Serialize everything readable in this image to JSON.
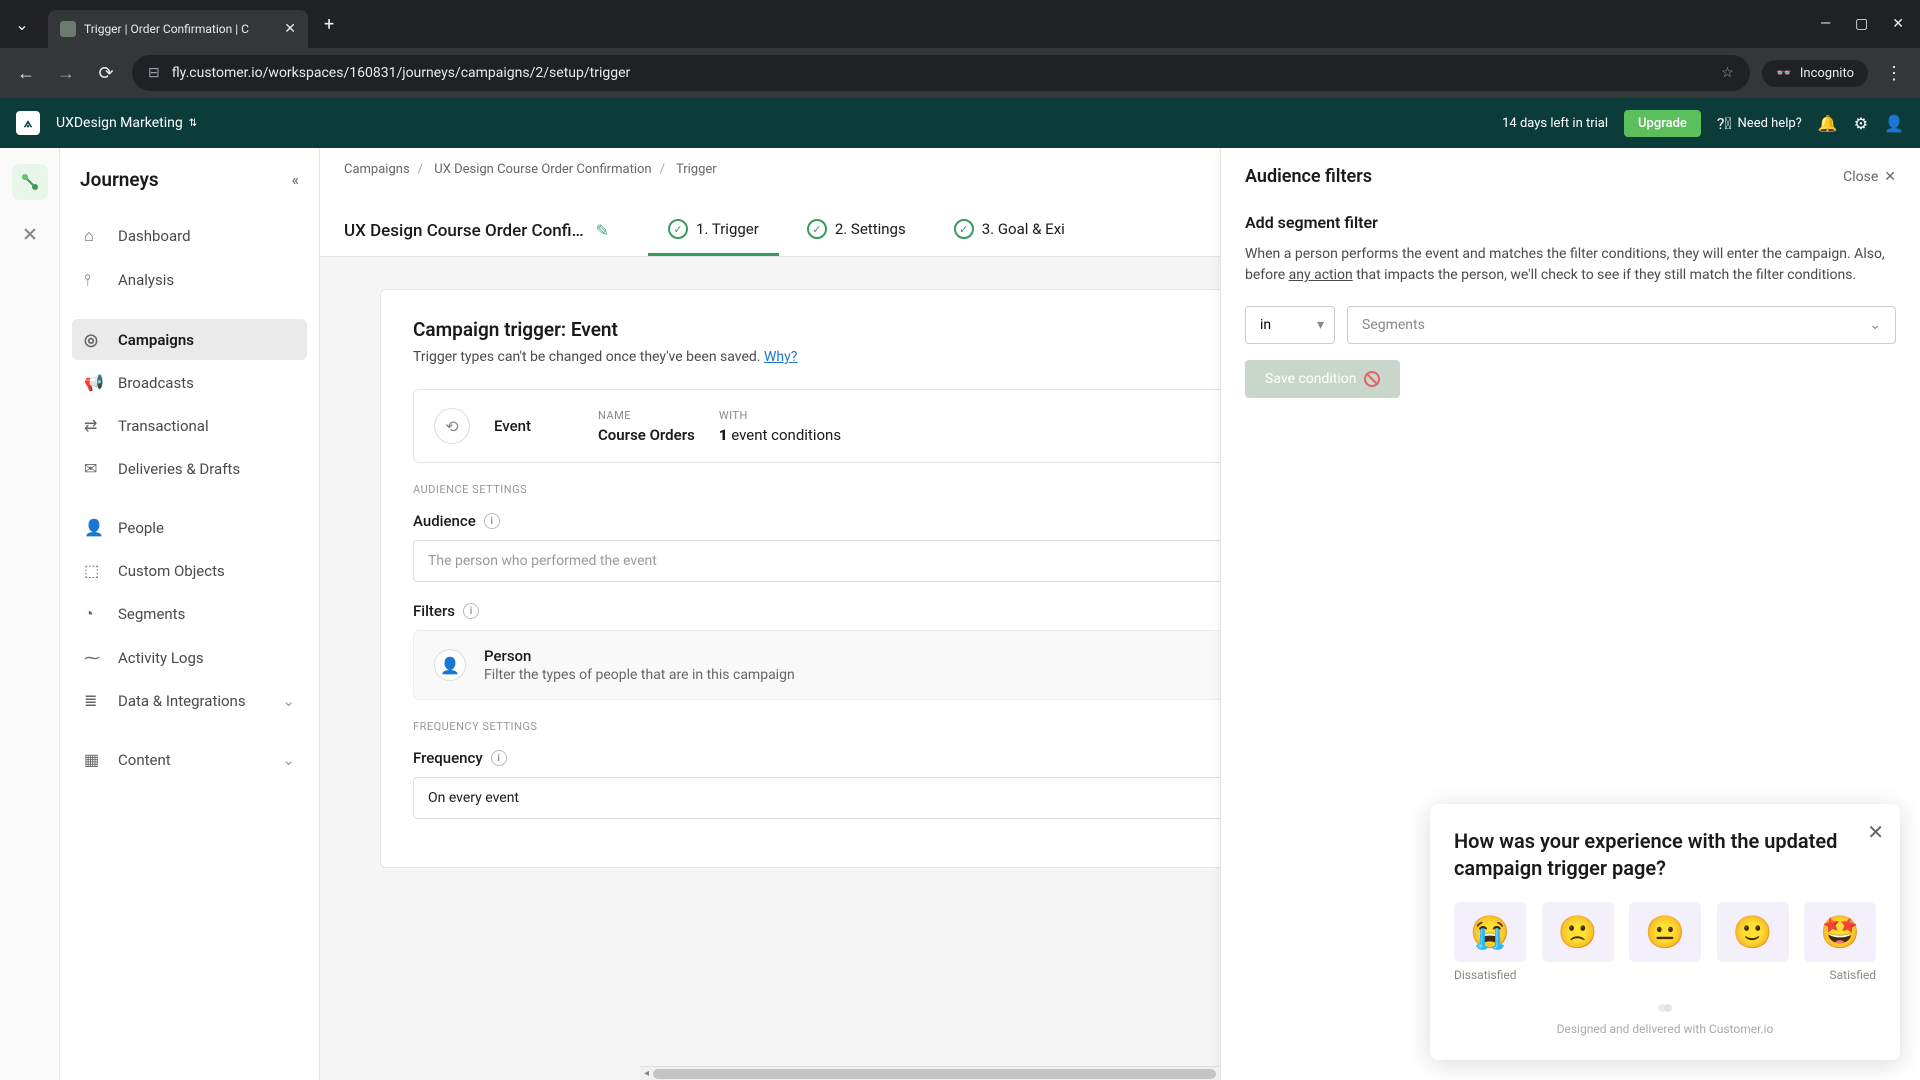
{
  "browser": {
    "tab_title": "Trigger | Order Confirmation | C",
    "url": "fly.customer.io/workspaces/160831/journeys/campaigns/2/setup/trigger",
    "incognito": "Incognito"
  },
  "header": {
    "workspace": "UXDesign Marketing",
    "trial": "14 days left in trial",
    "upgrade": "Upgrade",
    "need_help": "Need help?"
  },
  "sidebar": {
    "title": "Journeys",
    "items": [
      "Dashboard",
      "Analysis",
      "Campaigns",
      "Broadcasts",
      "Transactional",
      "Deliveries & Drafts",
      "People",
      "Custom Objects",
      "Segments",
      "Activity Logs",
      "Data & Integrations",
      "Content"
    ]
  },
  "breadcrumb": {
    "a": "Campaigns",
    "b": "UX Design Course Order Confirmation",
    "c": "Trigger"
  },
  "page": {
    "title": "UX Design Course Order Confi…",
    "steps": [
      "1. Trigger",
      "2. Settings",
      "3. Goal & Exi"
    ]
  },
  "trigger": {
    "heading": "Campaign trigger: Event",
    "sub_a": "Trigger types can't be changed once they've been saved. ",
    "sub_link": "Why?",
    "event_type": "Event",
    "name_label": "NAME",
    "name_value": "Course Orders",
    "with_label": "WITH",
    "with_count": "1",
    "with_suffix": " event conditions",
    "audience_section": "AUDIENCE SETTINGS",
    "audience_label": "Audience",
    "audience_value": "The person who performed the event",
    "filters_label": "Filters",
    "filter_title": "Person",
    "filter_desc": "Filter the types of people that are in this campaign",
    "frequency_section": "FREQUENCY SETTINGS",
    "frequency_label": "Frequency",
    "frequency_value": "On every event"
  },
  "panel": {
    "title": "Audience filters",
    "close": "Close",
    "section": "Add segment filter",
    "desc_a": "When a person performs the event and matches the filter conditions, they will enter the campaign. Also, before ",
    "desc_u": "any action",
    "desc_b": " that impacts the person, we'll check to see if they still match the filter conditions.",
    "operator": "in",
    "segments_placeholder": "Segments",
    "save": "Save condition"
  },
  "survey": {
    "question": "How was your experience with the updated campaign trigger page?",
    "low": "Dissatisfied",
    "high": "Satisfied",
    "emojis": [
      "😭",
      "🙁",
      "😐",
      "🙂",
      "🤩"
    ],
    "footer": "Designed and delivered with Customer.io"
  }
}
